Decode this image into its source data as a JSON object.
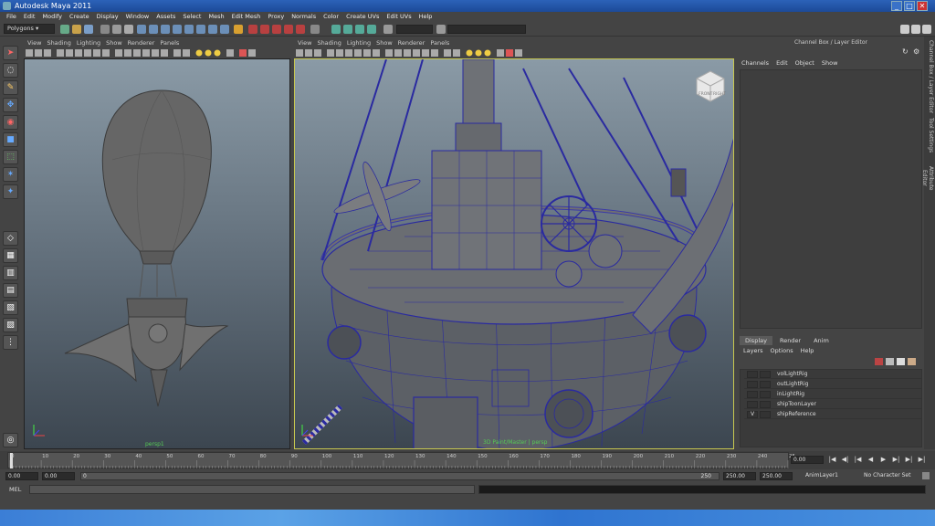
{
  "window": {
    "title": "Autodesk Maya 2011",
    "min": "_",
    "max": "□",
    "close": "✕"
  },
  "menu": [
    "File",
    "Edit",
    "Modify",
    "Create",
    "Display",
    "Window",
    "Assets",
    "Select",
    "Mesh",
    "Edit Mesh",
    "Proxy",
    "Normals",
    "Color",
    "Create UVs",
    "Edit UVs",
    "Help"
  ],
  "status": {
    "menu_set": "Polygons"
  },
  "viewport_menu": [
    "View",
    "Shading",
    "Lighting",
    "Show",
    "Renderer",
    "Panels"
  ],
  "viewport_left": {
    "camera": "persp1"
  },
  "viewport_right": {
    "camera": "3D Paint/Master | persp"
  },
  "viewcube": {
    "front": "FRONT",
    "right": "RIGHT"
  },
  "channel_box": {
    "title": "Channel Box / Layer Editor",
    "menu": [
      "Channels",
      "Edit",
      "Object",
      "Show"
    ]
  },
  "layer_editor": {
    "tabs": [
      "Display",
      "Render",
      "Anim"
    ],
    "menu": [
      "Layers",
      "Options",
      "Help"
    ],
    "layers": [
      {
        "visible": "",
        "name": "volLightRig"
      },
      {
        "visible": "",
        "name": "outLightRig"
      },
      {
        "visible": "",
        "name": "inLightRig"
      },
      {
        "visible": "",
        "name": "shipToonLayer"
      },
      {
        "visible": "V",
        "name": "shipReference"
      }
    ]
  },
  "side_tabs": [
    "Channel Box / Layer Editor",
    "Tool Settings",
    "Attribute Editor"
  ],
  "timeline": {
    "ticks": [
      "0",
      "10",
      "20",
      "30",
      "40",
      "50",
      "60",
      "70",
      "80",
      "90",
      "100",
      "110",
      "120",
      "130",
      "140",
      "150",
      "160",
      "170",
      "180",
      "190",
      "200",
      "210",
      "220",
      "230",
      "240",
      "25"
    ],
    "current_frame": "0.00"
  },
  "playback": [
    "|◀",
    "◀|",
    "|◀",
    "◀",
    "▶",
    "▶|",
    "▶|",
    "▶|"
  ],
  "range": {
    "start_time": "0.00",
    "start_playback": "0.00",
    "slider_start": "0",
    "slider_end": "250",
    "end_playback": "250.00",
    "end_time": "250.00",
    "anim_layer": "AnimLayer1",
    "character": "No Character Set"
  },
  "command_line": {
    "label": "MEL"
  },
  "colors": {
    "accent": "#c8c850",
    "wire": "#2a2aa0",
    "title": "#2c62b8"
  }
}
